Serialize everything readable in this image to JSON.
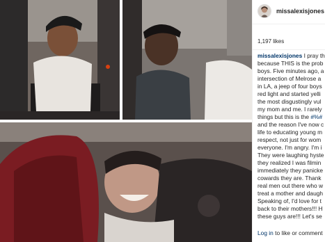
{
  "post": {
    "username": "missalexisjones",
    "likes": "1,197 likes"
  },
  "caption": {
    "author": "missalexisjones",
    "lines": [
      " I pray th",
      "because THIS is the prob",
      "boys. Five minutes ago, a",
      "intersection of Melrose a",
      "in LA, a jeep of four boys",
      "red light and started yelli",
      "the most disgustingly vul",
      "my mom and me. I rarely",
      "things but this is the ",
      "and the reason I've now c",
      "life to educating young m",
      "respect, not just for wom",
      "everyone. I'm angry. I'm i",
      "They were laughing hyste",
      "they realized I was filmin",
      "immediately they panicke",
      "cowards they are. Thank",
      "real men out there who w",
      "treat a mother and daugh",
      "Speaking of, I'd love for t",
      "back to their mothers!!! H",
      "these guys are!!! Let's se"
    ],
    "hashtag": "#%#"
  },
  "footer": {
    "login_link": "Log in",
    "login_rest": " to like or comment"
  },
  "colors": {
    "link": "#003569",
    "text": "#262626",
    "divider": "#efefef"
  },
  "icons": {
    "avatar": "user-avatar-photo"
  }
}
